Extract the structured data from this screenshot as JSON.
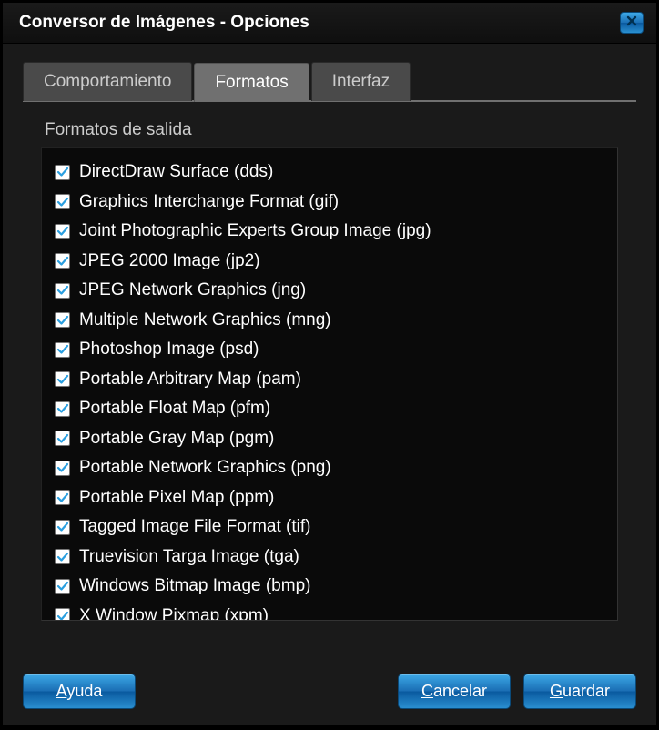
{
  "window": {
    "title": "Conversor de Imágenes - Opciones"
  },
  "tabs": [
    {
      "label": "Comportamiento",
      "active": false
    },
    {
      "label": "Formatos",
      "active": true
    },
    {
      "label": "Interfaz",
      "active": false
    }
  ],
  "panel": {
    "fieldset_label": "Formatos de salida",
    "formats": [
      {
        "label": "DirectDraw Surface (dds)",
        "checked": true
      },
      {
        "label": "Graphics Interchange Format (gif)",
        "checked": true
      },
      {
        "label": "Joint Photographic Experts Group Image (jpg)",
        "checked": true
      },
      {
        "label": "JPEG 2000 Image (jp2)",
        "checked": true
      },
      {
        "label": "JPEG Network Graphics (jng)",
        "checked": true
      },
      {
        "label": "Multiple Network Graphics (mng)",
        "checked": true
      },
      {
        "label": "Photoshop Image (psd)",
        "checked": true
      },
      {
        "label": "Portable Arbitrary Map (pam)",
        "checked": true
      },
      {
        "label": "Portable Float Map (pfm)",
        "checked": true
      },
      {
        "label": "Portable Gray Map (pgm)",
        "checked": true
      },
      {
        "label": "Portable Network Graphics (png)",
        "checked": true
      },
      {
        "label": "Portable Pixel Map (ppm)",
        "checked": true
      },
      {
        "label": "Tagged Image File Format (tif)",
        "checked": true
      },
      {
        "label": "Truevision Targa Image (tga)",
        "checked": true
      },
      {
        "label": "Windows Bitmap Image (bmp)",
        "checked": true
      },
      {
        "label": "X Window Pixmap (xpm)",
        "checked": true
      }
    ]
  },
  "buttons": {
    "help": "Ayuda",
    "cancel": "Cancelar",
    "save": "Guardar"
  },
  "colors": {
    "accent": "#1b7fc5",
    "bg": "#1a1a1a"
  }
}
